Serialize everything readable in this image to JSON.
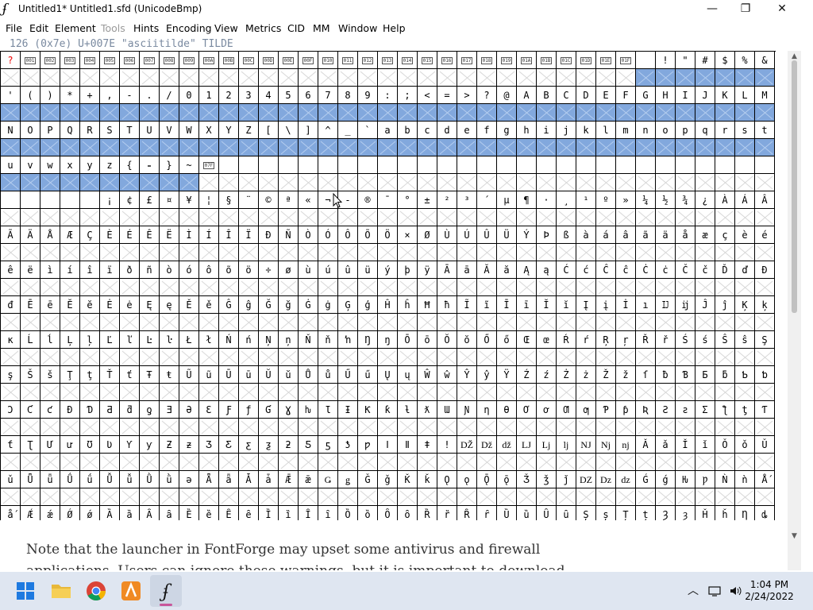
{
  "window": {
    "title": "Untitled1*  Untitled1.sfd (UnicodeBmp)",
    "controls": [
      "—",
      "❐",
      "✕"
    ]
  },
  "menu": [
    {
      "label": "File",
      "enabled": true
    },
    {
      "label": "Edit",
      "enabled": true
    },
    {
      "label": "Element",
      "enabled": true
    },
    {
      "label": "Tools",
      "enabled": false
    },
    {
      "label": "Hints",
      "enabled": true
    },
    {
      "label": "Encoding",
      "enabled": true
    },
    {
      "label": "View",
      "enabled": true
    },
    {
      "label": "Metrics",
      "enabled": true
    },
    {
      "label": "CID",
      "enabled": true
    },
    {
      "label": "MM",
      "enabled": true
    },
    {
      "label": "Window",
      "enabled": true
    },
    {
      "label": "Help",
      "enabled": true
    }
  ],
  "info_line": "126 (0x7e) U+007E \"asciitilde\" TILDE",
  "grid_rows": [
    {
      "labels": [
        "?",
        "|001",
        "|002",
        "|003",
        "|004",
        "|005",
        "|006",
        "|007",
        "|008",
        "|009",
        "|00A",
        "|00B",
        "|00C",
        "|00D",
        "|00E",
        "|00F",
        "|010",
        "|011",
        "|012",
        "|013",
        "|014",
        "|015",
        "|016",
        "|017",
        "|018",
        "|019",
        "|01A",
        "|01B",
        "|01C",
        "|01D",
        "|01E",
        "|01F",
        " ",
        "!",
        "\"",
        "#",
        "$",
        "%",
        "&"
      ],
      "selected_from": 32
    },
    {
      "labels": [
        "'",
        "(",
        ")",
        "*",
        "+",
        ",",
        "-",
        ".",
        "/",
        "0",
        "1",
        "2",
        "3",
        "4",
        "5",
        "6",
        "7",
        "8",
        "9",
        ":",
        ";",
        "<",
        "=",
        ">",
        "?",
        "@",
        "A",
        "B",
        "C",
        "D",
        "E",
        "F",
        "G",
        "H",
        "I",
        "J",
        "K",
        "L",
        "M"
      ],
      "selected_from": 0
    },
    {
      "labels": [
        "N",
        "O",
        "P",
        "Q",
        "R",
        "S",
        "T",
        "U",
        "V",
        "W",
        "X",
        "Y",
        "Z",
        "[",
        "\\",
        "]",
        "^",
        "_",
        "`",
        "a",
        "b",
        "c",
        "d",
        "e",
        "f",
        "g",
        "h",
        "i",
        "j",
        "k",
        "l",
        "m",
        "n",
        "o",
        "p",
        "q",
        "r",
        "s",
        "t"
      ],
      "selected_from": 0
    },
    {
      "labels": [
        "u",
        "v",
        "w",
        "x",
        "y",
        "z",
        "{",
        "|",
        "}",
        "~",
        "|07F",
        "",
        "",
        "",
        "",
        "",
        "",
        "",
        "",
        "",
        "",
        "",
        "",
        "",
        "",
        "",
        "",
        "",
        "",
        "",
        "",
        "",
        "",
        "",
        "",
        "",
        "",
        "",
        ""
      ],
      "selected_to": 10
    },
    {
      "labels": [
        "",
        "",
        "",
        "",
        "",
        "¡",
        "¢",
        "£",
        "¤",
        "¥",
        "¦",
        "§",
        "¨",
        "©",
        "ª",
        "«",
        "¬",
        "-",
        "®",
        "¯",
        "°",
        "±",
        "²",
        "³",
        "´",
        "µ",
        "¶",
        "·",
        "¸",
        "¹",
        "º",
        "»",
        "¼",
        "½",
        "¾",
        "¿",
        "À",
        "Á",
        "Â"
      ]
    },
    {
      "labels": [
        "Ã",
        "Ä",
        "Å",
        "Æ",
        "Ç",
        "È",
        "É",
        "Ê",
        "Ë",
        "Ì",
        "Í",
        "Î",
        "Ï",
        "Ð",
        "Ñ",
        "Ò",
        "Ó",
        "Ô",
        "Õ",
        "Ö",
        "×",
        "Ø",
        "Ù",
        "Ú",
        "Û",
        "Ü",
        "Ý",
        "Þ",
        "ß",
        "à",
        "á",
        "â",
        "ã",
        "ä",
        "å",
        "æ",
        "ç",
        "è",
        "é"
      ]
    },
    {
      "labels": [
        "ê",
        "ë",
        "ì",
        "í",
        "î",
        "ï",
        "ð",
        "ñ",
        "ò",
        "ó",
        "ô",
        "õ",
        "ö",
        "÷",
        "ø",
        "ù",
        "ú",
        "û",
        "ü",
        "ý",
        "þ",
        "ÿ",
        "Ā",
        "ā",
        "Ă",
        "ă",
        "Ą",
        "ą",
        "Ć",
        "ć",
        "Ĉ",
        "ĉ",
        "Ċ",
        "ċ",
        "Č",
        "č",
        "Ď",
        "ď",
        "Đ"
      ]
    },
    {
      "labels": [
        "đ",
        "Ē",
        "ē",
        "Ĕ",
        "ĕ",
        "Ė",
        "ė",
        "Ę",
        "ę",
        "Ě",
        "ě",
        "Ĝ",
        "ĝ",
        "Ğ",
        "ğ",
        "Ġ",
        "ġ",
        "Ģ",
        "ģ",
        "Ĥ",
        "ĥ",
        "Ħ",
        "ħ",
        "Ĩ",
        "ĩ",
        "Ī",
        "ī",
        "Ĭ",
        "ĭ",
        "Į",
        "į",
        "İ",
        "ı",
        "Ĳ",
        "ĳ",
        "Ĵ",
        "ĵ",
        "Ķ",
        "ķ"
      ]
    },
    {
      "labels": [
        "ĸ",
        "Ĺ",
        "ĺ",
        "Ļ",
        "ļ",
        "Ľ",
        "ľ",
        "Ŀ",
        "ŀ",
        "Ł",
        "ł",
        "Ń",
        "ń",
        "Ņ",
        "ņ",
        "Ň",
        "ň",
        "ŉ",
        "Ŋ",
        "ŋ",
        "Ō",
        "ō",
        "Ŏ",
        "ŏ",
        "Ő",
        "ő",
        "Œ",
        "œ",
        "Ŕ",
        "ŕ",
        "Ŗ",
        "ŗ",
        "Ř",
        "ř",
        "Ś",
        "ś",
        "Ŝ",
        "ŝ",
        "Ş"
      ]
    },
    {
      "labels": [
        "ş",
        "Š",
        "š",
        "Ţ",
        "ţ",
        "Ť",
        "ť",
        "Ŧ",
        "ŧ",
        "Ũ",
        "ũ",
        "Ū",
        "ū",
        "Ŭ",
        "ŭ",
        "Ů",
        "ů",
        "Ű",
        "ű",
        "Ų",
        "ų",
        "Ŵ",
        "ŵ",
        "Ŷ",
        "ŷ",
        "Ÿ",
        "Ź",
        "ź",
        "Ż",
        "ż",
        "Ž",
        "ž",
        "ſ",
        "ƀ",
        "Ɓ",
        "Ƃ",
        "ƃ",
        "Ƅ",
        "ƅ"
      ]
    },
    {
      "labels": [
        "Ɔ",
        "Ƈ",
        "ƈ",
        "Ɖ",
        "Ɗ",
        "Ƌ",
        "ƌ",
        "ƍ",
        "Ǝ",
        "Ə",
        "Ɛ",
        "Ƒ",
        "ƒ",
        "Ɠ",
        "Ɣ",
        "ƕ",
        "Ɩ",
        "Ɨ",
        "Ƙ",
        "ƙ",
        "ƚ",
        "ƛ",
        "Ɯ",
        "Ɲ",
        "ƞ",
        "Ɵ",
        "Ơ",
        "ơ",
        "Ƣ",
        "ƣ",
        "Ƥ",
        "ƥ",
        "Ʀ",
        "Ƨ",
        "ƨ",
        "Ʃ",
        "ƪ",
        "ƫ",
        "Ƭ"
      ]
    },
    {
      "labels": [
        "ƭ",
        "Ʈ",
        "Ư",
        "ư",
        "Ʊ",
        "Ʋ",
        "Ƴ",
        "ƴ",
        "Ƶ",
        "ƶ",
        "Ʒ",
        "Ƹ",
        "ƹ",
        "ƺ",
        "ƻ",
        "Ƽ",
        "ƽ",
        "ƾ",
        "ƿ",
        "ǀ",
        "ǁ",
        "ǂ",
        "ǃ",
        "Ǆ",
        "ǅ",
        "ǆ",
        "Ǉ",
        "ǈ",
        "ǉ",
        "Ǌ",
        "ǋ",
        "ǌ",
        "Ǎ",
        "ǎ",
        "Ǐ",
        "ǐ",
        "Ǒ",
        "ǒ",
        "Ǔ"
      ]
    },
    {
      "labels": [
        "ǔ",
        "Ǖ",
        "ǖ",
        "Ǘ",
        "ǘ",
        "Ǚ",
        "ǚ",
        "Ǜ",
        "ǜ",
        "ǝ",
        "Ǟ",
        "ǟ",
        "Ǡ",
        "ǡ",
        "Ǣ",
        "ǣ",
        "Ǥ",
        "ǥ",
        "Ǧ",
        "ǧ",
        "Ǩ",
        "ǩ",
        "Ǫ",
        "ǫ",
        "Ǭ",
        "ǭ",
        "Ǯ",
        "ǯ",
        "ǰ",
        "Ǳ",
        "ǲ",
        "ǳ",
        "Ǵ",
        "ǵ",
        "Ƕ",
        "Ƿ",
        "Ǹ",
        "ǹ",
        "Ǻ"
      ]
    },
    {
      "labels": [
        "ǻ",
        "Ǽ",
        "ǽ",
        "Ǿ",
        "ǿ",
        "Ȁ",
        "ȁ",
        "Ȃ",
        "ȃ",
        "Ȅ",
        "ȅ",
        "Ȇ",
        "ȇ",
        "Ȉ",
        "ȉ",
        "Ȋ",
        "ȋ",
        "Ȍ",
        "ȍ",
        "Ȏ",
        "ȏ",
        "Ȑ",
        "ȑ",
        "Ȓ",
        "ȓ",
        "Ȕ",
        "ȕ",
        "Ȗ",
        "ȗ",
        "Ș",
        "ș",
        "Ț",
        "ț",
        "Ȝ",
        "ȝ",
        "Ȟ",
        "ȟ",
        "Ƞ",
        "ȡ"
      ]
    }
  ],
  "article": {
    "text": "Note that the launcher in FontForge may upset some antivirus and firewall applications. Users can ignore these warnings, but it is important to download"
  },
  "taskbar": {
    "apps": [
      {
        "name": "start-button",
        "icon": "windows-logo"
      },
      {
        "name": "file-explorer-button",
        "icon": "folder-icon"
      },
      {
        "name": "chrome-button",
        "icon": "chrome-icon"
      },
      {
        "name": "app-orange-button",
        "icon": "app-icon"
      },
      {
        "name": "fontforge-taskbar-button",
        "icon": "fontforge-icon"
      }
    ],
    "clock": {
      "time": "1:04 PM",
      "date": "2/24/2022"
    }
  },
  "colors": {
    "selection": "#82a8dd",
    "taskbar": "#dfe6f1",
    "info_text": "#7a8aa0"
  }
}
